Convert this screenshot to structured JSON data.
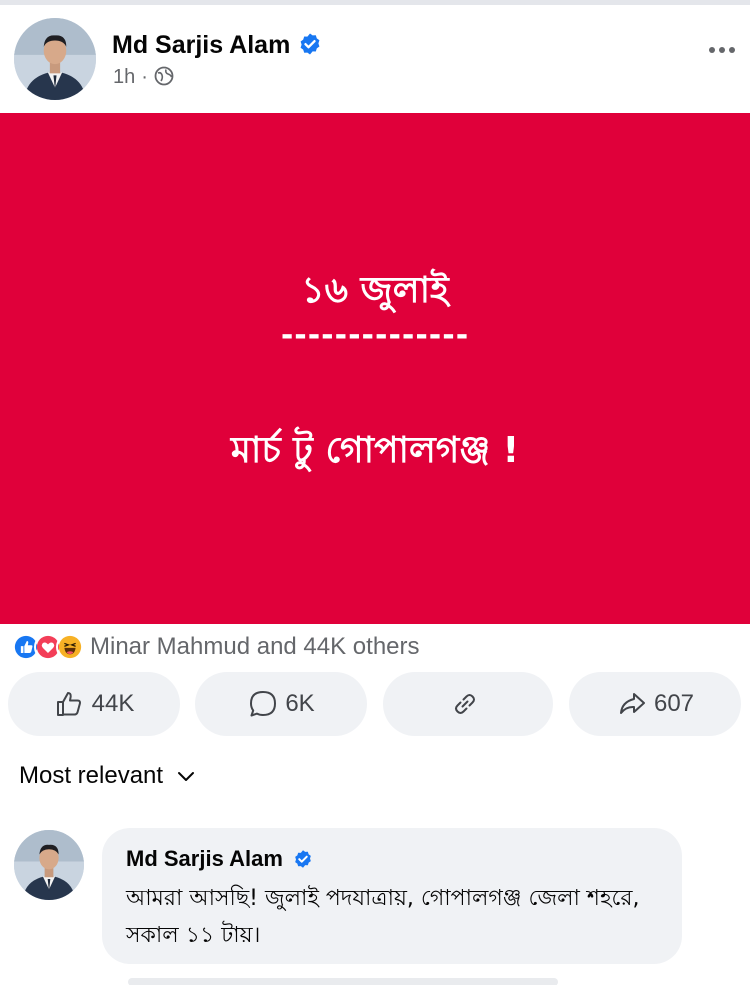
{
  "post": {
    "author": "Md Sarjis Alam",
    "time": "1h",
    "separator": "·"
  },
  "image": {
    "background_color": "#e0003a",
    "line1": "১৬ জুলাই",
    "line2": "--------------",
    "line3": "মার্চ টু গোপালগঞ্জ !"
  },
  "reactions": {
    "icons": [
      "like-icon",
      "love-icon",
      "haha-icon"
    ],
    "summary": "Minar Mahmud and 44K others"
  },
  "actions": {
    "like_count": "44K",
    "comment_count": "6K",
    "share_count": "607"
  },
  "comments": {
    "sort_label": "Most relevant",
    "items": [
      {
        "author": "Md Sarjis Alam",
        "text": "আমরা আসছি! জুলাই পদযাত্রায়, গোপালগঞ্জ জেলা শহরে, সকাল ১১ টায়।"
      }
    ]
  },
  "colors": {
    "verified": "#1877f2",
    "like": "#1877f2",
    "love": "#f33e58",
    "haha": "#f7b125",
    "muted_text": "#65676b"
  }
}
